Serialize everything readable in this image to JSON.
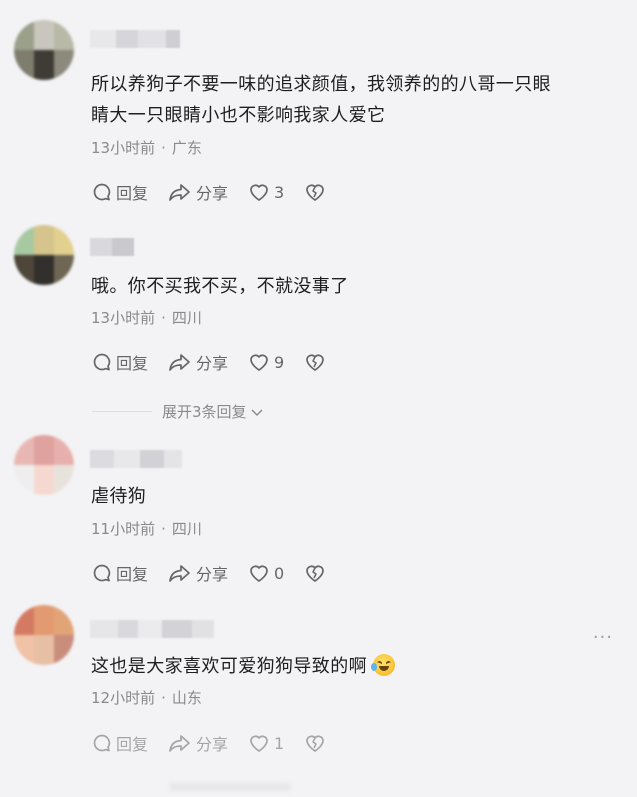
{
  "comments": [
    {
      "text_line1": "所以养狗子不要一味的追求颜值，我领养的的八哥一只眼",
      "text_line2": "睛大一只眼睛小也不影响我家人爱它",
      "time": "13小时前",
      "location": "广东",
      "reply_label": "回复",
      "share_label": "分享",
      "likes": "3",
      "avatar_colors": [
        "#9aa08a",
        "#c9c7bd",
        "#b9b9a7",
        "#7e7d6e",
        "#3f3b35",
        "#8b8a7c"
      ],
      "username_colors": [
        "#e8e8ea",
        "#d6d6da",
        "#e2e2e6",
        "#cfcfd3"
      ]
    },
    {
      "text_line1": "哦。你不买我不买，不就没事了",
      "time": "13小时前",
      "location": "四川",
      "reply_label": "回复",
      "share_label": "分享",
      "likes": "9",
      "avatar_colors": [
        "#a6c9a2",
        "#d5c48b",
        "#e2d08f",
        "#4e4639",
        "#32302d",
        "#6f6654"
      ],
      "username_colors": [
        "#d9d9dd",
        "#c9c9ce"
      ]
    },
    {
      "text_line1": "虐待狗",
      "time": "11小时前",
      "location": "四川",
      "reply_label": "回复",
      "share_label": "分享",
      "likes": "0",
      "avatar_colors": [
        "#e9b7b3",
        "#dfa29f",
        "#e7b0ac",
        "#eeeeee",
        "#f5d9d1",
        "#e8e2dc"
      ],
      "username_colors": [
        "#dcdce0",
        "#e8e8eb",
        "#d2d2d6",
        "#e4e4e7"
      ]
    },
    {
      "text_line1": "这也是大家喜欢可爱狗狗导致的啊",
      "time": "12小时前",
      "location": "山东",
      "reply_label": "回复",
      "share_label": "分享",
      "likes": "1",
      "avatar_colors": [
        "#d47a63",
        "#e39a70",
        "#e2a476",
        "#f0c2a6",
        "#e7bfa5",
        "#c98d7c"
      ],
      "username_colors": [
        "#e6e6e9",
        "#d9d9dd",
        "#ebebee",
        "#d3d3d7",
        "#e1e1e4"
      ]
    }
  ],
  "expand_replies": "展开3条回复",
  "more_label": "···",
  "colors": {
    "background": "#f3f3f5",
    "text": "#1e1e1e",
    "meta": "#8a8a8e",
    "icon": "#666666"
  }
}
